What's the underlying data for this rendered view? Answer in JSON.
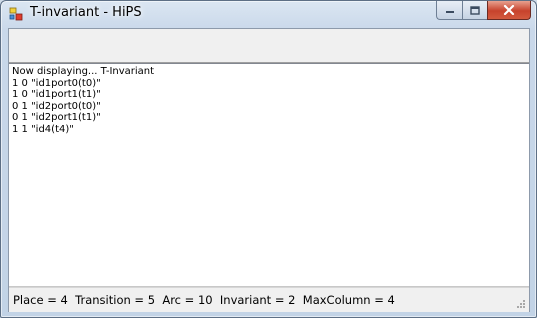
{
  "window": {
    "title": "T-invariant - HiPS"
  },
  "output": {
    "lines": [
      "Now displaying... T-Invariant",
      "1 0 \"id1port0(t0)\"",
      "1 0 \"id1port1(t1)\"",
      "0 1 \"id2port0(t0)\"",
      "0 1 \"id2port1(t1)\"",
      "1 1 \"id4(t4)\""
    ]
  },
  "status": {
    "text": "Place = 4  Transition = 5  Arc = 10  Invariant = 2  MaxColumn = 4"
  },
  "icons": {
    "app": "petri-net-app-icon",
    "minimize": "minimize-icon",
    "maximize": "maximize-icon",
    "close": "close-icon",
    "grip": "resize-grip-icon"
  },
  "colors": {
    "window_frame": "#c9d8ea",
    "close_button": "#c7422c",
    "client_background": "#f0f0f0",
    "output_background": "#ffffff"
  }
}
